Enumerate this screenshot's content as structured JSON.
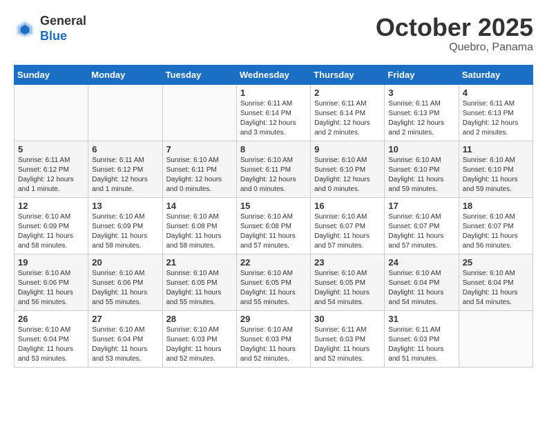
{
  "header": {
    "logo_line1": "General",
    "logo_line2": "Blue",
    "month": "October 2025",
    "location": "Quebro, Panama"
  },
  "weekdays": [
    "Sunday",
    "Monday",
    "Tuesday",
    "Wednesday",
    "Thursday",
    "Friday",
    "Saturday"
  ],
  "weeks": [
    [
      {
        "day": "",
        "info": ""
      },
      {
        "day": "",
        "info": ""
      },
      {
        "day": "",
        "info": ""
      },
      {
        "day": "1",
        "info": "Sunrise: 6:11 AM\nSunset: 6:14 PM\nDaylight: 12 hours\nand 3 minutes."
      },
      {
        "day": "2",
        "info": "Sunrise: 6:11 AM\nSunset: 6:14 PM\nDaylight: 12 hours\nand 2 minutes."
      },
      {
        "day": "3",
        "info": "Sunrise: 6:11 AM\nSunset: 6:13 PM\nDaylight: 12 hours\nand 2 minutes."
      },
      {
        "day": "4",
        "info": "Sunrise: 6:11 AM\nSunset: 6:13 PM\nDaylight: 12 hours\nand 2 minutes."
      }
    ],
    [
      {
        "day": "5",
        "info": "Sunrise: 6:11 AM\nSunset: 6:12 PM\nDaylight: 12 hours\nand 1 minute."
      },
      {
        "day": "6",
        "info": "Sunrise: 6:11 AM\nSunset: 6:12 PM\nDaylight: 12 hours\nand 1 minute."
      },
      {
        "day": "7",
        "info": "Sunrise: 6:10 AM\nSunset: 6:11 PM\nDaylight: 12 hours\nand 0 minutes."
      },
      {
        "day": "8",
        "info": "Sunrise: 6:10 AM\nSunset: 6:11 PM\nDaylight: 12 hours\nand 0 minutes."
      },
      {
        "day": "9",
        "info": "Sunrise: 6:10 AM\nSunset: 6:10 PM\nDaylight: 12 hours\nand 0 minutes."
      },
      {
        "day": "10",
        "info": "Sunrise: 6:10 AM\nSunset: 6:10 PM\nDaylight: 11 hours\nand 59 minutes."
      },
      {
        "day": "11",
        "info": "Sunrise: 6:10 AM\nSunset: 6:10 PM\nDaylight: 11 hours\nand 59 minutes."
      }
    ],
    [
      {
        "day": "12",
        "info": "Sunrise: 6:10 AM\nSunset: 6:09 PM\nDaylight: 11 hours\nand 58 minutes."
      },
      {
        "day": "13",
        "info": "Sunrise: 6:10 AM\nSunset: 6:09 PM\nDaylight: 11 hours\nand 58 minutes."
      },
      {
        "day": "14",
        "info": "Sunrise: 6:10 AM\nSunset: 6:08 PM\nDaylight: 11 hours\nand 58 minutes."
      },
      {
        "day": "15",
        "info": "Sunrise: 6:10 AM\nSunset: 6:08 PM\nDaylight: 11 hours\nand 57 minutes."
      },
      {
        "day": "16",
        "info": "Sunrise: 6:10 AM\nSunset: 6:07 PM\nDaylight: 11 hours\nand 57 minutes."
      },
      {
        "day": "17",
        "info": "Sunrise: 6:10 AM\nSunset: 6:07 PM\nDaylight: 11 hours\nand 57 minutes."
      },
      {
        "day": "18",
        "info": "Sunrise: 6:10 AM\nSunset: 6:07 PM\nDaylight: 11 hours\nand 56 minutes."
      }
    ],
    [
      {
        "day": "19",
        "info": "Sunrise: 6:10 AM\nSunset: 6:06 PM\nDaylight: 11 hours\nand 56 minutes."
      },
      {
        "day": "20",
        "info": "Sunrise: 6:10 AM\nSunset: 6:06 PM\nDaylight: 11 hours\nand 55 minutes."
      },
      {
        "day": "21",
        "info": "Sunrise: 6:10 AM\nSunset: 6:05 PM\nDaylight: 11 hours\nand 55 minutes."
      },
      {
        "day": "22",
        "info": "Sunrise: 6:10 AM\nSunset: 6:05 PM\nDaylight: 11 hours\nand 55 minutes."
      },
      {
        "day": "23",
        "info": "Sunrise: 6:10 AM\nSunset: 6:05 PM\nDaylight: 11 hours\nand 54 minutes."
      },
      {
        "day": "24",
        "info": "Sunrise: 6:10 AM\nSunset: 6:04 PM\nDaylight: 11 hours\nand 54 minutes."
      },
      {
        "day": "25",
        "info": "Sunrise: 6:10 AM\nSunset: 6:04 PM\nDaylight: 11 hours\nand 54 minutes."
      }
    ],
    [
      {
        "day": "26",
        "info": "Sunrise: 6:10 AM\nSunset: 6:04 PM\nDaylight: 11 hours\nand 53 minutes."
      },
      {
        "day": "27",
        "info": "Sunrise: 6:10 AM\nSunset: 6:04 PM\nDaylight: 11 hours\nand 53 minutes."
      },
      {
        "day": "28",
        "info": "Sunrise: 6:10 AM\nSunset: 6:03 PM\nDaylight: 11 hours\nand 52 minutes."
      },
      {
        "day": "29",
        "info": "Sunrise: 6:10 AM\nSunset: 6:03 PM\nDaylight: 11 hours\nand 52 minutes."
      },
      {
        "day": "30",
        "info": "Sunrise: 6:11 AM\nSunset: 6:03 PM\nDaylight: 11 hours\nand 52 minutes."
      },
      {
        "day": "31",
        "info": "Sunrise: 6:11 AM\nSunset: 6:03 PM\nDaylight: 11 hours\nand 51 minutes."
      },
      {
        "day": "",
        "info": ""
      }
    ]
  ]
}
